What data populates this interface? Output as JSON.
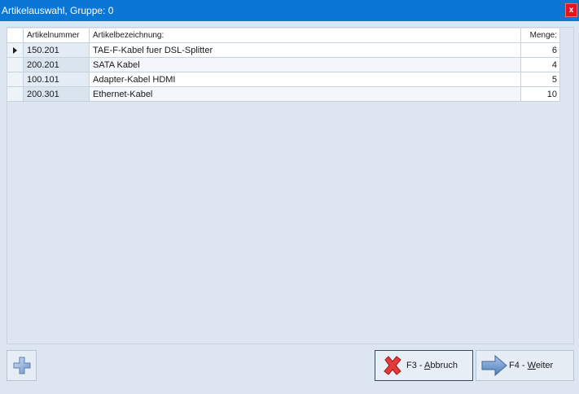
{
  "window": {
    "title": "Artikelauswahl, Gruppe: 0",
    "close_label": "x"
  },
  "table": {
    "columns": [
      "Artikelnummer",
      "Artikelbezeichnung:",
      "Menge:"
    ],
    "rows": [
      {
        "nummer": "150.201",
        "bezeichnung": "TAE-F-Kabel fuer DSL-Splitter",
        "menge": "6"
      },
      {
        "nummer": "200.201",
        "bezeichnung": "SATA Kabel",
        "menge": "4"
      },
      {
        "nummer": "100.101",
        "bezeichnung": "Adapter-Kabel HDMI",
        "menge": "5"
      },
      {
        "nummer": "200.301",
        "bezeichnung": "Ethernet-Kabel",
        "menge": "10"
      }
    ],
    "selected_row": 0
  },
  "buttons": {
    "add_icon": "plus-icon",
    "cancel": {
      "prefix": "F3 - ",
      "accel": "A",
      "rest": "bbruch",
      "icon": "red-x-icon"
    },
    "next": {
      "prefix": "F4 - ",
      "accel": "W",
      "rest": "eiter",
      "icon": "arrow-right-icon"
    }
  },
  "colors": {
    "titlebar": "#0a77d6",
    "close": "#e81123",
    "background": "#dde6f0"
  }
}
